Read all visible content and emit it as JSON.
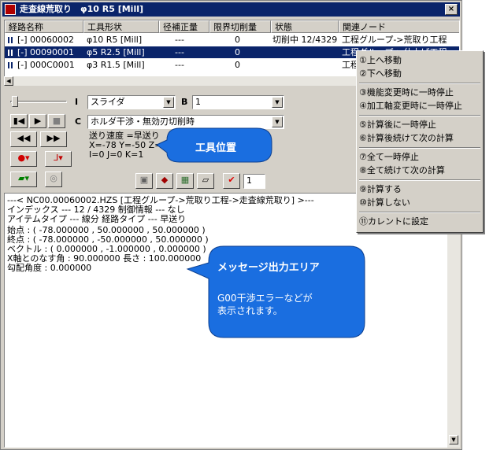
{
  "window": {
    "title": "走査線荒取り　φ10 R5 [Mill]",
    "close": "×"
  },
  "list": {
    "columns": [
      "経路名称",
      "工具形状",
      "径補正量",
      "限界切削量",
      "状態",
      "関連ノード"
    ],
    "rows": [
      {
        "name": "[-] 00060002",
        "tool": "φ10 R5 [Mill]",
        "comp": "---",
        "limit": "0",
        "state": "切削中 12/4329",
        "node": "工程グループ->荒取り工程"
      },
      {
        "name": "[-] 00090001",
        "tool": "φ5 R2.5 [Mill]",
        "comp": "---",
        "limit": "0",
        "state": "",
        "node": "工程グループ->仕上げ工程",
        "selected": true
      },
      {
        "name": "[-] 000C0001",
        "tool": "φ3 R1.5 [Mill]",
        "comp": "---",
        "limit": "0",
        "state": "",
        "node": "工程"
      }
    ]
  },
  "controls": {
    "label_i": "I",
    "combo_i": "スライダ",
    "label_b": "B",
    "combo_b": "1",
    "label_c": "C",
    "combo_c": "ホルダ干渉・無効刃切削時",
    "frame_value": "1"
  },
  "info": {
    "line1": "送り速度 =早送り",
    "line2": "X=-78 Y=-50 Z=50",
    "line3": "I=0 J=0 K=1"
  },
  "callouts": {
    "tool_position": "工具位置",
    "message_title": "メッセージ出力エリア",
    "message_body1": "G00干渉エラーなどが",
    "message_body2": "表示されます。"
  },
  "messages": [
    "---< NC00.00060002.HZS [工程グループ->荒取り工程->走査線荒取り] >---",
    "インデックス ---        12 / 4329      制御情報 --- なし",
    "アイテムタイプ  ---    線分        経路タイプ  ---    早送り",
    "始点    : ( -78.000000 , 50.000000 , 50.000000 )",
    "終点    : ( -78.000000 , -50.000000 , 50.000000 )",
    "ベクトル : ( 0.000000 , -1.000000 , 0.000000 )",
    "X軸とのなす角 : 90.000000  長さ : 100.000000",
    "勾配角度 : 0.000000"
  ],
  "menu": {
    "items": [
      "①上へ移動",
      "②下へ移動",
      "③機能変更時に一時停止",
      "④加工軸変更時に一時停止",
      "⑤計算後に一時停止",
      "⑥計算後続けて次の計算",
      "⑦全て一時停止",
      "⑧全て続けて次の計算",
      "⑨計算する",
      "⑩計算しない",
      "⑪カレントに設定"
    ]
  },
  "colors": {
    "title_bar": "#0a246a",
    "selection": "#0a246a",
    "callout": "#1a6ee0",
    "face": "#d4d0c8"
  }
}
